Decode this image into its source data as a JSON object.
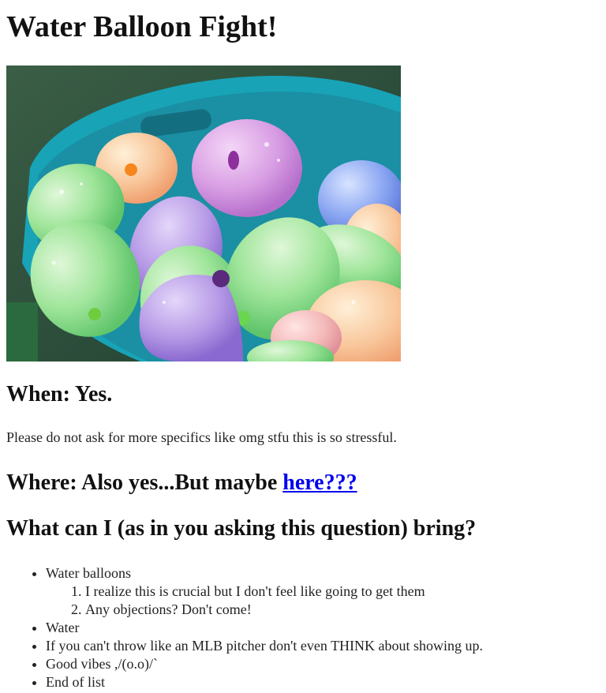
{
  "page": {
    "title": "Water Balloon Fight!"
  },
  "when": {
    "heading": "When: Yes.",
    "text": "Please do not ask for more specifics like omg stfu this is so stressful."
  },
  "where": {
    "heading_prefix": "Where: Also yes...But maybe ",
    "link_text": "here???"
  },
  "what": {
    "heading": "What can I (as in you asking this question) bring?",
    "items": [
      {
        "label": "Water balloons",
        "subitems": [
          "I realize this is crucial but I don't feel like going to get them",
          "Any objections? Don't come!"
        ]
      },
      {
        "label": "Water"
      },
      {
        "label": "If you can't throw like an MLB pitcher don't even THINK about showing up."
      },
      {
        "label": "Good vibes ,/(o.o)/`"
      },
      {
        "label": "End of list"
      }
    ]
  },
  "colors": {
    "link": "#0000ee",
    "bucket": "#1aa0b4",
    "grass": "#2f5d44"
  }
}
